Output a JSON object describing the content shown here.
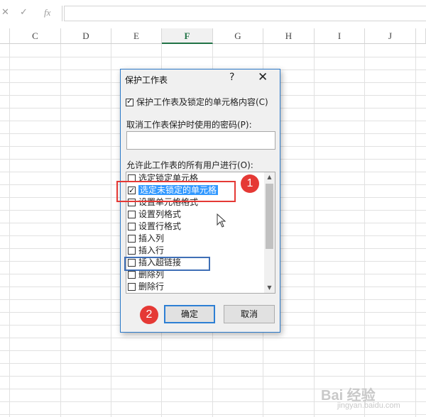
{
  "formula_bar": {
    "cancel_icon": "✕",
    "enter_icon": "✓",
    "fx_label": "fx"
  },
  "columns": [
    {
      "label": "C",
      "selected": false
    },
    {
      "label": "D",
      "selected": false
    },
    {
      "label": "E",
      "selected": false
    },
    {
      "label": "F",
      "selected": true
    },
    {
      "label": "G",
      "selected": false
    },
    {
      "label": "H",
      "selected": false
    },
    {
      "label": "I",
      "selected": false
    },
    {
      "label": "J",
      "selected": false
    }
  ],
  "dialog": {
    "title": "保护工作表",
    "help": "?",
    "close": "✕",
    "protect_label": "保护工作表及锁定的单元格内容(C)",
    "protect_checked": true,
    "password_label": "取消工作表保护时使用的密码(P):",
    "password_value": "",
    "allow_label": "允许此工作表的所有用户进行(O):",
    "permissions": [
      {
        "label": "选定锁定单元格",
        "checked": false
      },
      {
        "label": "选定未锁定的单元格",
        "checked": true,
        "highlighted": true
      },
      {
        "label": "设置单元格格式",
        "checked": false
      },
      {
        "label": "设置列格式",
        "checked": false
      },
      {
        "label": "设置行格式",
        "checked": false
      },
      {
        "label": "插入列",
        "checked": false
      },
      {
        "label": "插入行",
        "checked": false
      },
      {
        "label": "插入超链接",
        "checked": false
      },
      {
        "label": "删除列",
        "checked": false
      },
      {
        "label": "删除行",
        "checked": false
      }
    ],
    "ok_label": "确定",
    "cancel_label": "取消"
  },
  "annotations": {
    "badge_1": "1",
    "badge_2": "2"
  },
  "watermark": {
    "text": "Bai 经验",
    "sub": "jingyan.baidu.com"
  },
  "colors": {
    "accent_green": "#217346",
    "annotation_red": "#e53935",
    "annotation_blue": "#3f6fb6",
    "dialog_border": "#2b79c9"
  }
}
